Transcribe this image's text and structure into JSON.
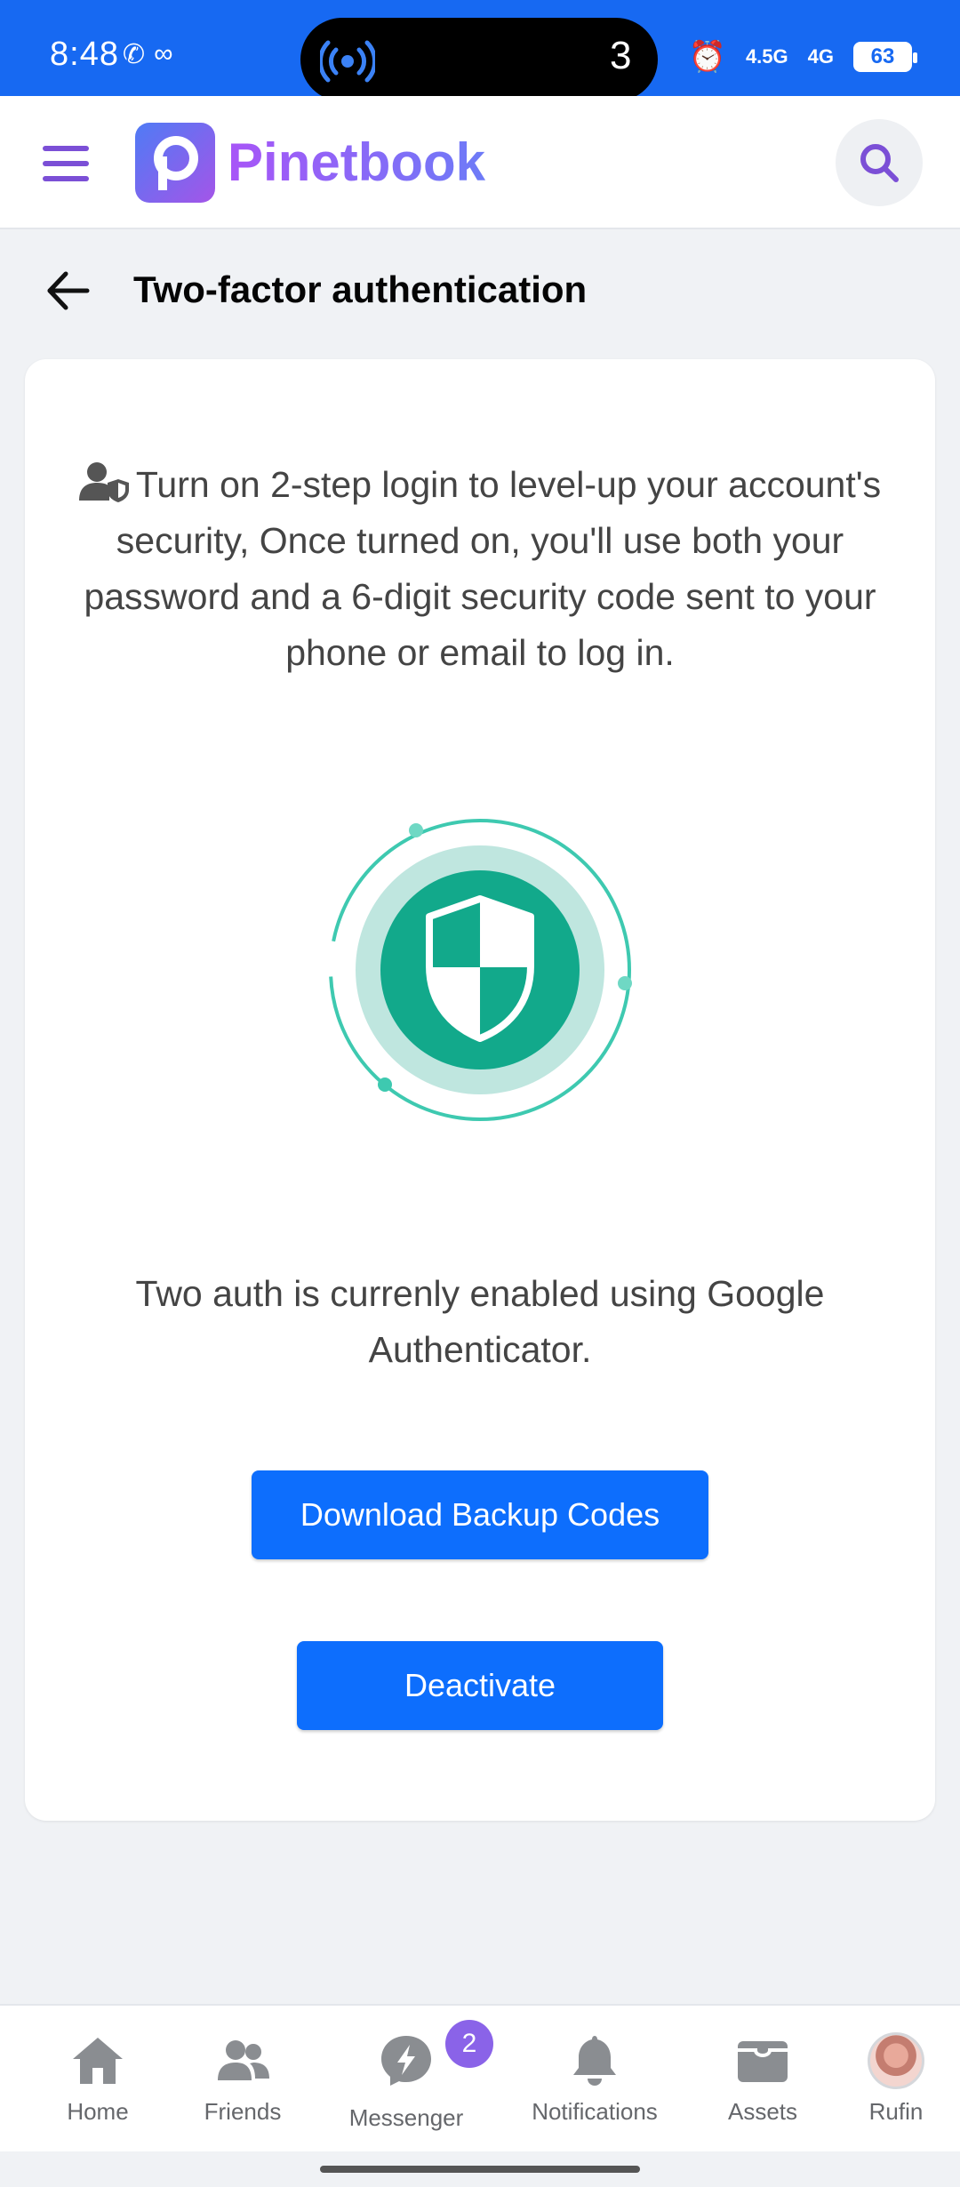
{
  "status_bar": {
    "time": "8:48",
    "island_count": "3",
    "network_1": "4.5G",
    "network_2": "4G",
    "battery": "63"
  },
  "header": {
    "app_name": "Pinetbook"
  },
  "page": {
    "title": "Two-factor authentication",
    "intro": "Turn on 2-step login to level-up your account's security, Once turned on, you'll use both your password and a 6-digit security code sent to your phone or email to log in.",
    "status_message": "Two auth is currenly enabled using Google Authenticator.",
    "download_button": "Download Backup Codes",
    "deactivate_button": "Deactivate"
  },
  "bottom_nav": {
    "home": "Home",
    "friends": "Friends",
    "messenger": "Messenger",
    "messenger_badge": "2",
    "notifications": "Notifications",
    "assets": "Assets",
    "profile": "Rufin"
  },
  "colors": {
    "status_bar": "#1769f2",
    "primary_button": "#0d6efd",
    "brand_purple": "#a855f7",
    "shield_green": "#12a98b"
  }
}
